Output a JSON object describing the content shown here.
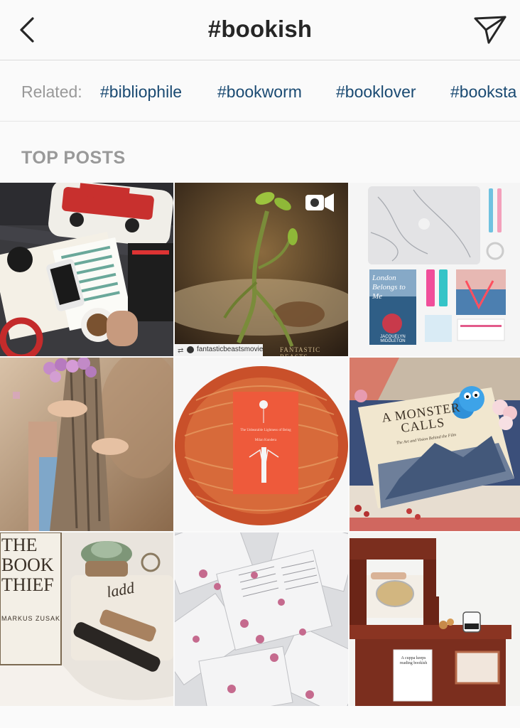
{
  "header": {
    "title": "#bookish",
    "back_icon": "chevron-left-icon",
    "share_icon": "paper-plane-icon"
  },
  "related": {
    "label": "Related:",
    "tags": [
      "#bibliophile",
      "#bookworm",
      "#booklover",
      "#booksta"
    ]
  },
  "section": {
    "title": "TOP POSTS"
  },
  "posts": [
    {
      "kind": "photo"
    },
    {
      "kind": "video",
      "repost_user": "fantasticbeastsmovie",
      "watermark": "FANTASTIC BEASTS"
    },
    {
      "kind": "photo",
      "book_title": "London Belongs to Me",
      "book_author": "JACQUELYN MIDDLETON"
    },
    {
      "kind": "photo"
    },
    {
      "kind": "photo",
      "book_title": "The Unbearable Lightness of Being",
      "book_author": "Milan Kundera"
    },
    {
      "kind": "photo",
      "book_title": "A MONSTER CALLS",
      "book_subtitle": "The Art and Vision Behind the Film"
    },
    {
      "kind": "photo",
      "book_title": "THE BOOK THIEF",
      "book_author": "MARKUS ZUSAK",
      "mug_text": "ladd"
    },
    {
      "kind": "photo"
    },
    {
      "kind": "photo",
      "bag_text": "A cuppa keeps reading bookish"
    }
  ],
  "colors": {
    "tag_link": "#1a4a72",
    "muted": "#999999",
    "divider": "#dbdbdb"
  }
}
